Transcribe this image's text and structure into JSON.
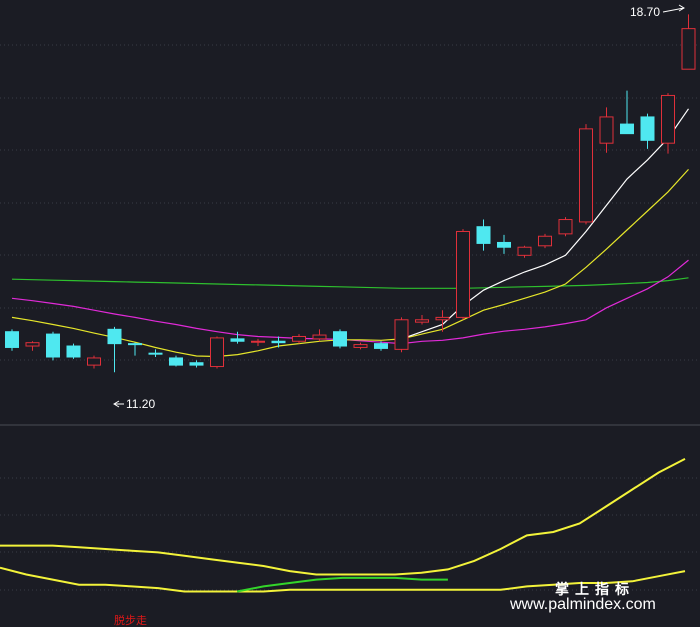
{
  "annotations": {
    "high_label": "18.70",
    "low_label": "11.20"
  },
  "indicator_label": "脱步走",
  "watermark": {
    "cn": "掌上指标",
    "url": "www.palmindex.com"
  },
  "colors": {
    "background": "#1b1c24",
    "grid": "#3a3b46",
    "up_candle": "#e0303a",
    "down_candle": "#4fe8f0",
    "ma_white": "#ffffff",
    "ma_yellow": "#e6e62a",
    "ma_magenta": "#e12ad8",
    "ma_green": "#2ec02e",
    "indicator_main": "#f3f33a",
    "indicator_green": "#33d52a",
    "label_red": "#e01818"
  },
  "chart_data": [
    {
      "type": "candlestick",
      "title": "",
      "ylim": [
        10.2,
        19.0
      ],
      "grid": "horizontal dashed",
      "candles": [
        {
          "o": 12.05,
          "h": 12.1,
          "l": 11.65,
          "c": 11.72
        },
        {
          "o": 11.75,
          "h": 11.85,
          "l": 11.65,
          "c": 11.82
        },
        {
          "o": 12.0,
          "h": 12.05,
          "l": 11.45,
          "c": 11.52
        },
        {
          "o": 11.75,
          "h": 11.8,
          "l": 11.48,
          "c": 11.52
        },
        {
          "o": 11.35,
          "h": 11.55,
          "l": 11.28,
          "c": 11.5
        },
        {
          "o": 12.1,
          "h": 12.15,
          "l": 11.2,
          "c": 11.8
        },
        {
          "o": 11.8,
          "h": 11.82,
          "l": 11.55,
          "c": 11.78
        },
        {
          "o": 11.6,
          "h": 11.68,
          "l": 11.52,
          "c": 11.58
        },
        {
          "o": 11.5,
          "h": 11.55,
          "l": 11.32,
          "c": 11.35
        },
        {
          "o": 11.4,
          "h": 11.45,
          "l": 11.3,
          "c": 11.35
        },
        {
          "o": 11.32,
          "h": 11.95,
          "l": 11.28,
          "c": 11.92
        },
        {
          "o": 11.9,
          "h": 12.05,
          "l": 11.8,
          "c": 11.85
        },
        {
          "o": 11.85,
          "h": 11.9,
          "l": 11.75,
          "c": 11.85
        },
        {
          "o": 11.85,
          "h": 11.95,
          "l": 11.72,
          "c": 11.82
        },
        {
          "o": 11.85,
          "h": 12.0,
          "l": 11.8,
          "c": 11.95
        },
        {
          "o": 11.9,
          "h": 12.1,
          "l": 11.85,
          "c": 11.98
        },
        {
          "o": 12.05,
          "h": 12.1,
          "l": 11.7,
          "c": 11.75
        },
        {
          "o": 11.72,
          "h": 11.82,
          "l": 11.68,
          "c": 11.78
        },
        {
          "o": 11.8,
          "h": 11.85,
          "l": 11.65,
          "c": 11.7
        },
        {
          "o": 11.68,
          "h": 12.35,
          "l": 11.62,
          "c": 12.3
        },
        {
          "o": 12.25,
          "h": 12.4,
          "l": 12.2,
          "c": 12.3
        },
        {
          "o": 12.3,
          "h": 12.5,
          "l": 12.05,
          "c": 12.35
        },
        {
          "o": 12.35,
          "h": 14.2,
          "l": 12.3,
          "c": 14.15
        },
        {
          "o": 14.25,
          "h": 14.4,
          "l": 13.75,
          "c": 13.9
        },
        {
          "o": 13.92,
          "h": 14.08,
          "l": 13.68,
          "c": 13.82
        },
        {
          "o": 13.65,
          "h": 13.85,
          "l": 13.6,
          "c": 13.82
        },
        {
          "o": 13.85,
          "h": 14.1,
          "l": 13.8,
          "c": 14.05
        },
        {
          "o": 14.1,
          "h": 14.45,
          "l": 14.05,
          "c": 14.4
        },
        {
          "o": 14.35,
          "h": 16.4,
          "l": 14.3,
          "c": 16.3
        },
        {
          "o": 16.0,
          "h": 16.75,
          "l": 15.8,
          "c": 16.55
        },
        {
          "o": 16.4,
          "h": 17.1,
          "l": 16.3,
          "c": 16.2
        },
        {
          "o": 16.55,
          "h": 16.62,
          "l": 15.88,
          "c": 16.06
        },
        {
          "o": 16.0,
          "h": 17.05,
          "l": 15.78,
          "c": 17.0
        },
        {
          "o": 17.55,
          "h": 18.7,
          "l": 17.55,
          "c": 18.4
        }
      ],
      "moving_averages": [
        {
          "color_key": "ma_green",
          "values": [
            13.15,
            13.14,
            13.13,
            13.12,
            13.11,
            13.1,
            13.09,
            13.08,
            13.07,
            13.06,
            13.05,
            13.04,
            13.03,
            13.02,
            13.01,
            13.0,
            12.99,
            12.98,
            12.97,
            12.96,
            12.96,
            12.96,
            12.96,
            12.97,
            12.98,
            12.99,
            13.0,
            13.01,
            13.02,
            13.04,
            13.06,
            13.08,
            13.12,
            13.18
          ]
        },
        {
          "color_key": "ma_magenta",
          "values": [
            12.75,
            12.7,
            12.64,
            12.58,
            12.5,
            12.42,
            12.35,
            12.27,
            12.2,
            12.12,
            12.05,
            11.99,
            11.95,
            11.93,
            11.91,
            11.9,
            11.89,
            11.86,
            11.83,
            11.8,
            11.85,
            11.87,
            11.92,
            12.0,
            12.06,
            12.1,
            12.15,
            12.22,
            12.3,
            12.55,
            12.75,
            12.95,
            13.2,
            13.55
          ]
        },
        {
          "color_key": "ma_yellow",
          "values": [
            12.35,
            12.28,
            12.2,
            12.12,
            12.02,
            11.93,
            11.83,
            11.72,
            11.62,
            11.54,
            11.53,
            11.57,
            11.65,
            11.75,
            11.8,
            11.85,
            11.88,
            11.88,
            11.87,
            11.9,
            12.0,
            12.1,
            12.3,
            12.5,
            12.62,
            12.75,
            12.88,
            13.05,
            13.4,
            13.78,
            14.18,
            14.58,
            14.98,
            15.45
          ]
        },
        {
          "color_key": "ma_white",
          "values": [
            null,
            null,
            null,
            null,
            null,
            null,
            null,
            null,
            null,
            null,
            null,
            null,
            null,
            null,
            null,
            null,
            null,
            null,
            null,
            11.9,
            12.05,
            12.2,
            12.6,
            12.92,
            13.12,
            13.3,
            13.45,
            13.65,
            14.15,
            14.7,
            15.25,
            15.65,
            16.1,
            16.72
          ]
        }
      ]
    },
    {
      "type": "line",
      "title": "",
      "ylim": [
        0,
        100
      ],
      "series": [
        {
          "color_key": "indicator_main",
          "values": [
            32,
            32,
            32,
            31,
            30,
            29,
            28,
            26,
            24,
            22,
            20,
            17,
            15,
            15,
            15,
            15,
            16,
            18,
            23,
            30,
            38,
            40,
            45,
            55,
            65,
            75,
            83
          ]
        },
        {
          "color_key": "indicator_main",
          "values": [
            19,
            15,
            12,
            9,
            9,
            8,
            7,
            5,
            5,
            5,
            5,
            6,
            6,
            6,
            6,
            6,
            6,
            6,
            6,
            6,
            8,
            9,
            10,
            10,
            11,
            14,
            17
          ]
        },
        {
          "color_key": "indicator_green",
          "values": [
            null,
            null,
            null,
            null,
            null,
            null,
            null,
            null,
            null,
            5,
            8,
            10,
            12,
            13,
            13,
            13,
            12,
            12,
            null,
            null,
            null,
            null,
            null,
            null,
            null,
            null,
            null
          ]
        }
      ]
    }
  ]
}
